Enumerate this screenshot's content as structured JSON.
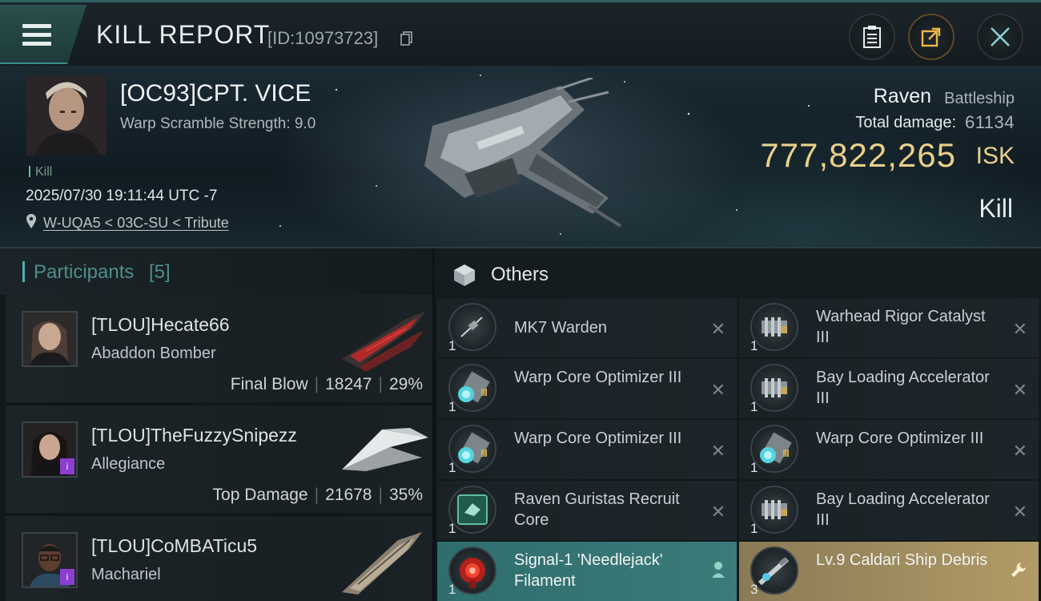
{
  "header": {
    "title": "KILL REPORT",
    "report_id": "[ID:10973723]"
  },
  "victim": {
    "name": "[OC93]CPT. VICE",
    "warp_scramble": "Warp Scramble Strength: 9.0",
    "tag": "Kill",
    "datetime": "2025/07/30 19:11:44 UTC -7",
    "location": "W-UQA5 < 03C-SU < Tribute",
    "ship_name": "Raven",
    "ship_class": "Battleship",
    "damage_label": "Total damage:",
    "damage_value": "61134",
    "isk_value": "777,822,265",
    "isk_unit": "ISK",
    "result": "Kill"
  },
  "participants": {
    "title": "Participants",
    "count": "[5]",
    "rows": [
      {
        "name": "[TLOU]Hecate66",
        "ship": "Abaddon Bomber",
        "stat_label": "Final Blow",
        "damage": "18247",
        "percent": "29%"
      },
      {
        "name": "[TLOU]TheFuzzySnipezz",
        "ship": "Allegiance",
        "stat_label": "Top Damage",
        "damage": "21678",
        "percent": "35%",
        "badge": "i"
      },
      {
        "name": "[TLOU]CoMBATicu5",
        "ship": "Machariel",
        "badge": "i"
      }
    ]
  },
  "others": {
    "title": "Others",
    "items": [
      {
        "name": "MK7  Warden",
        "qty": "1",
        "icon": "drone-icon"
      },
      {
        "name": "Warhead Rigor Catalyst III",
        "qty": "1",
        "tier": "III",
        "icon": "rig-icon"
      },
      {
        "name": "Warp Core Optimizer III",
        "qty": "1",
        "tier": "III",
        "icon": "warp-core-icon"
      },
      {
        "name": "Bay Loading Accelerator III",
        "qty": "1",
        "tier": "III",
        "icon": "rig-icon"
      },
      {
        "name": "Warp Core Optimizer III",
        "qty": "1",
        "tier": "III",
        "icon": "warp-core-icon"
      },
      {
        "name": "Warp Core Optimizer III",
        "qty": "1",
        "tier": "III",
        "icon": "warp-core-icon"
      },
      {
        "name": "Raven Guristas Recruit Core",
        "qty": "1",
        "icon": "core-icon"
      },
      {
        "name": "Bay Loading Accelerator III",
        "qty": "1",
        "tier": "III",
        "icon": "rig-icon"
      },
      {
        "name": "Signal-1 'Needlejack' Filament",
        "qty": "1",
        "icon": "filament-icon",
        "state": "person-icon"
      },
      {
        "name": "Lv.9 Caldari Ship Debris",
        "qty": "3",
        "icon": "debris-icon",
        "state": "wrench-icon"
      }
    ]
  },
  "colors": {
    "accent_teal": "#52b2ae",
    "isk_gold": "#e9cf8a",
    "dropped_teal": "#3b7b79",
    "loot_gold": "#b19b67"
  }
}
